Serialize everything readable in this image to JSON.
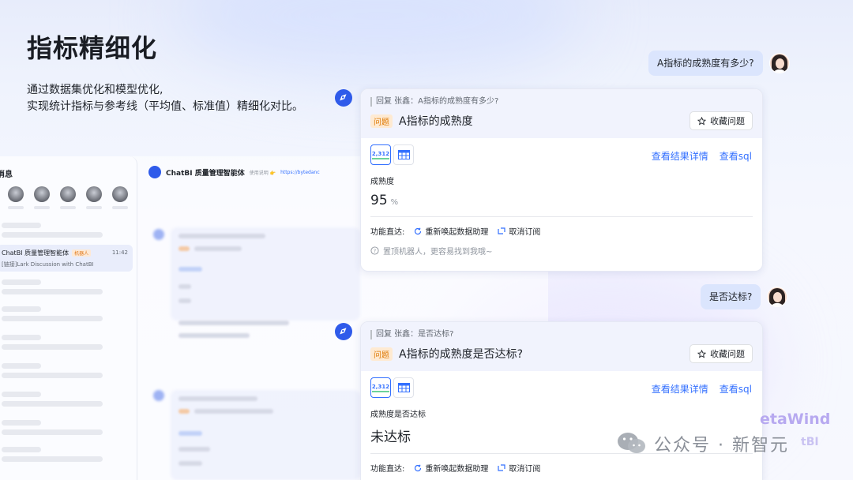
{
  "intro": {
    "title": "指标精细化",
    "desc_line1": "通过数据集优化和模型优化,",
    "desc_line2": "实现统计指标与参考线（平均值、标准值）精细化对比。"
  },
  "background_app": {
    "sidebar_title": "消息",
    "chat_item": {
      "name": "ChatBI 质量管理智能体",
      "tag": "机器人",
      "time": "11:42",
      "subtitle": "[链接]Lark Discussion with ChatBI"
    },
    "header": {
      "name": "ChatBI 质量管理智能体",
      "sub": "使用说明 👉",
      "link": "https://bytedanc"
    }
  },
  "conversation": {
    "user_question_1": "A指标的成熟度有多少?",
    "user_question_2": "是否达标?",
    "card1": {
      "reply_ref": "回复 张鑫：A指标的成熟度有多少?",
      "q_tag": "问题",
      "q_text": "A指标的成熟度",
      "fav_label": "收藏问题",
      "view_icon_number": "2,312",
      "link_details": "查看结果详情",
      "link_sql": "查看sql",
      "metric_name": "成熟度",
      "metric_value": "95",
      "metric_unit": "%",
      "func_label": "功能直达:",
      "func_reawaken": "重新唤起数据助理",
      "func_unsubscribe": "取消订阅",
      "tip": "置顶机器人，更容易找到我哦~"
    },
    "card2": {
      "reply_ref": "回复 张鑫：是否达标?",
      "q_tag": "问题",
      "q_text": "A指标的成熟度是否达标?",
      "fav_label": "收藏问题",
      "view_icon_number": "2,312",
      "link_details": "查看结果详情",
      "link_sql": "查看sql",
      "metric_name": "成熟度是否达标",
      "metric_value": "未达标",
      "func_label": "功能直达:",
      "func_reawaken": "重新唤起数据助理",
      "func_unsubscribe": "取消订阅"
    }
  },
  "watermark": {
    "text": "公众号 · 新智元",
    "brand_line1": "etaWind",
    "brand_line2": "tBI"
  },
  "colors": {
    "accent": "#3370ff",
    "bot": "#2f5bea",
    "tag_orange": "#de7802",
    "bubble": "#dbe5fd"
  }
}
